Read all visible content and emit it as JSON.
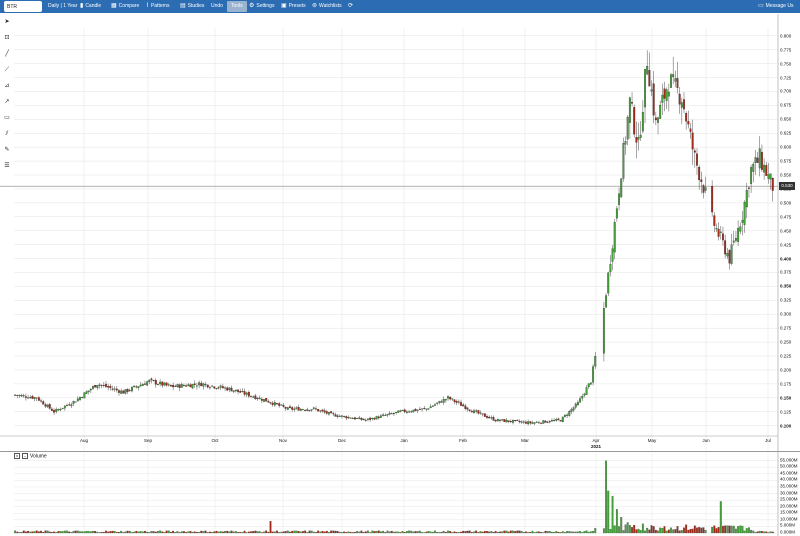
{
  "topbar": {
    "symbol_value": "BTR",
    "period_label": "Daily | 1 Year",
    "candle_label": "Candle",
    "compare_label": "Compare",
    "patterns_label": "Patterns",
    "studies_label": "Studies",
    "undo_label": "Undo",
    "tools_label": "Tools",
    "settings_label": "Settings",
    "presets_label": "Presets",
    "watchlists_label": "Watchlists",
    "message_label": "Message Us"
  },
  "toolbar_icons": [
    "pointer-icon",
    "zoom-icon",
    "line-icon",
    "ray-icon",
    "fib-icon",
    "arrow-icon",
    "rectangle-icon",
    "channel-icon",
    "brush-icon",
    "text-icon"
  ],
  "price_axis": {
    "labels": [
      "0.800",
      "0.775",
      "0.750",
      "0.725",
      "0.700",
      "0.675",
      "0.650",
      "0.625",
      "0.600",
      "0.575",
      "0.550",
      "0.525",
      "0.500",
      "0.475",
      "0.450",
      "0.425",
      "0.400",
      "0.375",
      "0.350",
      "0.325",
      "0.300",
      "0.275",
      "0.250",
      "0.225",
      "0.200",
      "0.175",
      "0.150",
      "0.125",
      "0.100"
    ],
    "bold": [
      "0.400",
      "0.350",
      "0.150",
      "0.100"
    ],
    "current_price": "0.530"
  },
  "date_axis": {
    "labels": [
      "Aug",
      "Sep",
      "Oct",
      "Nov",
      "Dec",
      "Jan",
      "Feb",
      "Mar",
      "Apr",
      "May",
      "Jun",
      "Jul"
    ],
    "year": "2021"
  },
  "volume": {
    "header": "Volume",
    "close_box": "x",
    "labels": [
      "55.000M",
      "50.000M",
      "45.000M",
      "40.000M",
      "35.000M",
      "30.000M",
      "25.000M",
      "20.000M",
      "15.000M",
      "10.000M",
      "5.000M",
      "0.000M"
    ]
  },
  "chart_data": {
    "type": "candlestick",
    "up_color": "#46a23c",
    "down_color": "#a52a1a",
    "ylim": [
      0.085,
      0.805
    ],
    "months": [
      "Aug",
      "Sep",
      "Oct",
      "Nov",
      "Dec",
      "Jan",
      "Feb",
      "Mar",
      "Apr",
      "May",
      "Jun",
      "Jul"
    ],
    "close_anchors": [
      {
        "t": 0,
        "v": 0.155
      },
      {
        "t": 10,
        "v": 0.15
      },
      {
        "t": 18,
        "v": 0.125
      },
      {
        "t": 28,
        "v": 0.145
      },
      {
        "t": 38,
        "v": 0.175
      },
      {
        "t": 50,
        "v": 0.16
      },
      {
        "t": 62,
        "v": 0.18
      },
      {
        "t": 72,
        "v": 0.17
      },
      {
        "t": 86,
        "v": 0.175
      },
      {
        "t": 100,
        "v": 0.165
      },
      {
        "t": 116,
        "v": 0.145
      },
      {
        "t": 126,
        "v": 0.13
      },
      {
        "t": 138,
        "v": 0.13
      },
      {
        "t": 146,
        "v": 0.12
      },
      {
        "t": 162,
        "v": 0.11
      },
      {
        "t": 178,
        "v": 0.125
      },
      {
        "t": 190,
        "v": 0.13
      },
      {
        "t": 200,
        "v": 0.15
      },
      {
        "t": 212,
        "v": 0.125
      },
      {
        "t": 222,
        "v": 0.11
      },
      {
        "t": 238,
        "v": 0.105
      },
      {
        "t": 252,
        "v": 0.11
      },
      {
        "t": 260,
        "v": 0.14
      },
      {
        "t": 266,
        "v": 0.18
      },
      {
        "t": 272,
        "v": 0.31
      },
      {
        "t": 276,
        "v": 0.43
      },
      {
        "t": 280,
        "v": 0.56
      },
      {
        "t": 284,
        "v": 0.68
      },
      {
        "t": 288,
        "v": 0.6
      },
      {
        "t": 292,
        "v": 0.76
      },
      {
        "t": 296,
        "v": 0.64
      },
      {
        "t": 302,
        "v": 0.72
      },
      {
        "t": 308,
        "v": 0.69
      },
      {
        "t": 314,
        "v": 0.58
      },
      {
        "t": 318,
        "v": 0.53
      },
      {
        "t": 322,
        "v": 0.47
      },
      {
        "t": 330,
        "v": 0.4
      },
      {
        "t": 336,
        "v": 0.48
      },
      {
        "t": 340,
        "v": 0.56
      },
      {
        "t": 344,
        "v": 0.58
      },
      {
        "t": 350,
        "v": 0.53
      }
    ],
    "gaps": [
      [
        269,
        271
      ],
      [
        320,
        321
      ]
    ],
    "volume_ylim": [
      0,
      57000000
    ],
    "volume_spikes": [
      {
        "t": 273,
        "v": 55000000
      },
      {
        "t": 274,
        "v": 32000000
      },
      {
        "t": 276,
        "v": 28000000
      },
      {
        "t": 278,
        "v": 18000000
      },
      {
        "t": 280,
        "v": 12000000
      },
      {
        "t": 283,
        "v": 8000000
      },
      {
        "t": 286,
        "v": 6000000
      },
      {
        "t": 290,
        "v": 7000000
      },
      {
        "t": 300,
        "v": 5000000
      },
      {
        "t": 326,
        "v": 24000000
      },
      {
        "t": 118,
        "v": 9000000
      }
    ]
  }
}
